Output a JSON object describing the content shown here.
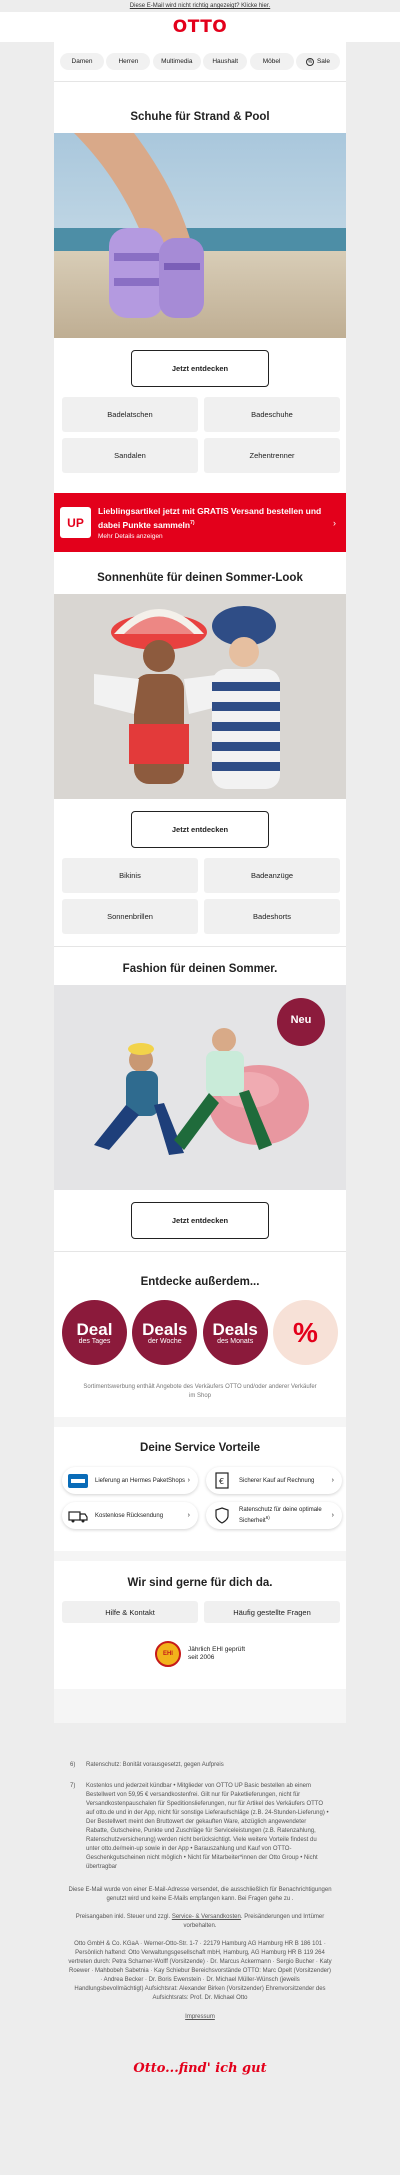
{
  "top_note": "Diese E-Mail wird nicht richtig angezeigt? Klicke hier.",
  "logo": "OTTO",
  "nav": {
    "items": [
      "Damen",
      "Herren",
      "Multimedia",
      "Haushalt",
      "Möbel"
    ],
    "sale": "Sale"
  },
  "section1": {
    "title": "Schuhe für Strand & Pool",
    "cta": "Jetzt entdecken",
    "tiles": [
      "Badelatschen",
      "Badeschuhe",
      "Sandalen",
      "Zehentrenner"
    ]
  },
  "banner": {
    "badge": "UP",
    "title": "Lieblingsartikel jetzt mit GRATIS Versand bestellen und dabei Punkte sammeln",
    "sup": "7)",
    "sub": "Mehr Details anzeigen"
  },
  "section2": {
    "title": "Sonnenhüte für deinen Sommer-Look",
    "cta": "Jetzt entdecken",
    "tiles": [
      "Bikinis",
      "Badeanzüge",
      "Sonnenbrillen",
      "Badeshorts"
    ]
  },
  "section3": {
    "title": "Fashion für deinen Sommer.",
    "badge": "Neu",
    "cta": "Jetzt entdecken"
  },
  "discover": {
    "title": "Entdecke außerdem...",
    "deals": [
      {
        "big": "Deal",
        "small": "des Tages"
      },
      {
        "big": "Deals",
        "small": "der Woche"
      },
      {
        "big": "Deals",
        "small": "des Monats"
      }
    ],
    "percent": "%",
    "note": "Sortimentswerbung enthält Angebote des Verkäufers OTTO und/oder anderer Verkäufer im Shop"
  },
  "service": {
    "title": "Deine Service Vorteile",
    "items": [
      {
        "label": "Lieferung an Hermes PaketShops",
        "icon": "hermes-icon"
      },
      {
        "label": "Sicherer Kauf auf Rechnung",
        "icon": "invoice-icon"
      },
      {
        "label": "Kostenlose Rücksendung",
        "icon": "return-truck-icon"
      },
      {
        "label": "Ratenschutz für deine optimale Sicherheit",
        "sup": "6)",
        "icon": "shield-icon"
      }
    ]
  },
  "help": {
    "title": "Wir sind gerne für dich da.",
    "items": [
      "Hilfe & Kontakt",
      "Häufig gestellte Fragen"
    ],
    "ehi_seal": "EHI",
    "ehi_text_1": "Jährlich EHI geprüft",
    "ehi_text_2": "seit 2006"
  },
  "footer": {
    "notes": [
      {
        "num": "6)",
        "text": "Ratenschutz: Bonität vorausgesetzt, gegen Aufpreis"
      },
      {
        "num": "7)",
        "text": "Kostenlos und jederzeit kündbar • Mitglieder von OTTO UP Basic bestellen ab einem Bestellwert von 59,95 € versandkostenfrei. Gilt nur für Paketlieferungen, nicht für Versandkostenpauschalen für Speditionslieferungen, nur für Artikel des Verkäufers OTTO auf otto.de und in der App, nicht für sonstige Lieferaufschläge (z.B. 24-Stunden-Lieferung) • Der Bestellwert meint den Bruttowert der gekauften Ware, abzüglich angewendeter Rabatte, Gutscheine, Punkte und Zuschläge für Serviceleistungen (z.B. Ratenzahlung, Ratenschutzversicherung) werden nicht berücksichtigt. Viele weitere Vorteile findest du unter otto.de/mein-up sowie in der App • Barauszahlung und Kauf von OTTO-Geschenkgutscheinen nicht möglich • Nicht für Mitarbeiter*innen der Otto Group • Nicht übertragbar"
      }
    ],
    "email_info": "Diese E-Mail wurde von einer E-Mail-Adresse versendet, die ausschließlich für Benachrichtigungen genutzt wird und keine E-Mails empfangen kann. Bei Fragen gehe zu .",
    "prices_a": "Preisangaben inkl. Steuer und zzgl.",
    "prices_link": "Service- & Versandkosten",
    "prices_b": ". Preisänderungen und Irrtümer vorbehalten.",
    "company": "Otto GmbH & Co. KGaA · Werner-Otto-Str. 1-7 · 22179 Hamburg AG Hamburg HR B 186 101 · Persönlich haftend: Otto Verwaltungsgesellschaft mbH, Hamburg, AG Hamburg HR B 119 264 vertreten durch: Petra Scharner-Wolff (Vorsitzende) · Dr. Marcus Ackermann · Sergio Bucher · Katy Roewer · Mahbobeh Sabetnia · Kay Schiebur Bereichsvorstände OTTO: Marc Opelt (Vorsitzender) · Andrea Becker · Dr. Boris Ewenstein · Dr. Michael Müller-Wünsch (jeweils Handlungsbevollmächtigt) Aufsichtsrat: Alexander Birken (Vorsitzender) Ehrenvorsitzender des Aufsichtsrats: Prof. Dr. Michael Otto",
    "impressum": "Impressum",
    "signature": "Otto...find' ich gut"
  }
}
